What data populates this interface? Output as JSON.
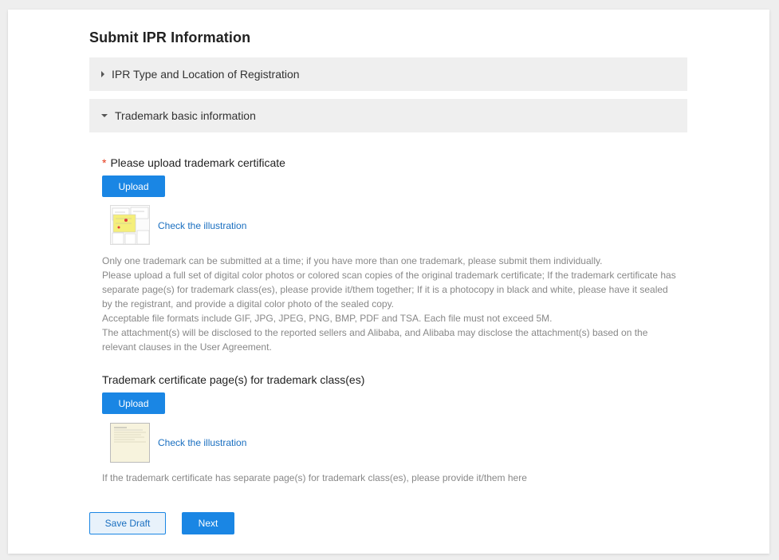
{
  "page": {
    "title": "Submit IPR Information"
  },
  "sections": [
    {
      "label": "IPR Type and Location of Registration",
      "expanded": false
    },
    {
      "label": "Trademark basic information",
      "expanded": true
    }
  ],
  "certificate_upload": {
    "required_mark": "*",
    "label": "Please upload trademark certificate",
    "upload_label": "Upload",
    "illustration_link": "Check the illustration",
    "help_lines": [
      "Only one trademark can be submitted at a time; if you have more than one trademark, please submit them individually.",
      "Please upload a full set of digital color photos or colored scan copies of the original trademark certificate; If the trademark certificate has separate page(s) for trademark class(es), please provide it/them together; If it is a photocopy in black and white, please have it sealed by the registrant, and provide a digital color photo of the sealed copy.",
      "Acceptable file formats include GIF, JPG, JPEG, PNG, BMP, PDF and TSA. Each file must not exceed 5M.",
      "The attachment(s) will be disclosed to the reported sellers and Alibaba, and Alibaba may disclose the attachment(s) based on the relevant clauses in the User Agreement."
    ]
  },
  "class_pages_upload": {
    "label": "Trademark certificate page(s) for trademark class(es)",
    "upload_label": "Upload",
    "illustration_link": "Check the illustration",
    "help": "If the trademark certificate has separate page(s) for trademark class(es), please provide it/them here"
  },
  "actions": {
    "save_draft": "Save Draft",
    "next": "Next"
  },
  "colors": {
    "primary": "#1a86e4",
    "link": "#1a6fc0",
    "required": "#e5391a",
    "section_bg": "#efefef"
  }
}
